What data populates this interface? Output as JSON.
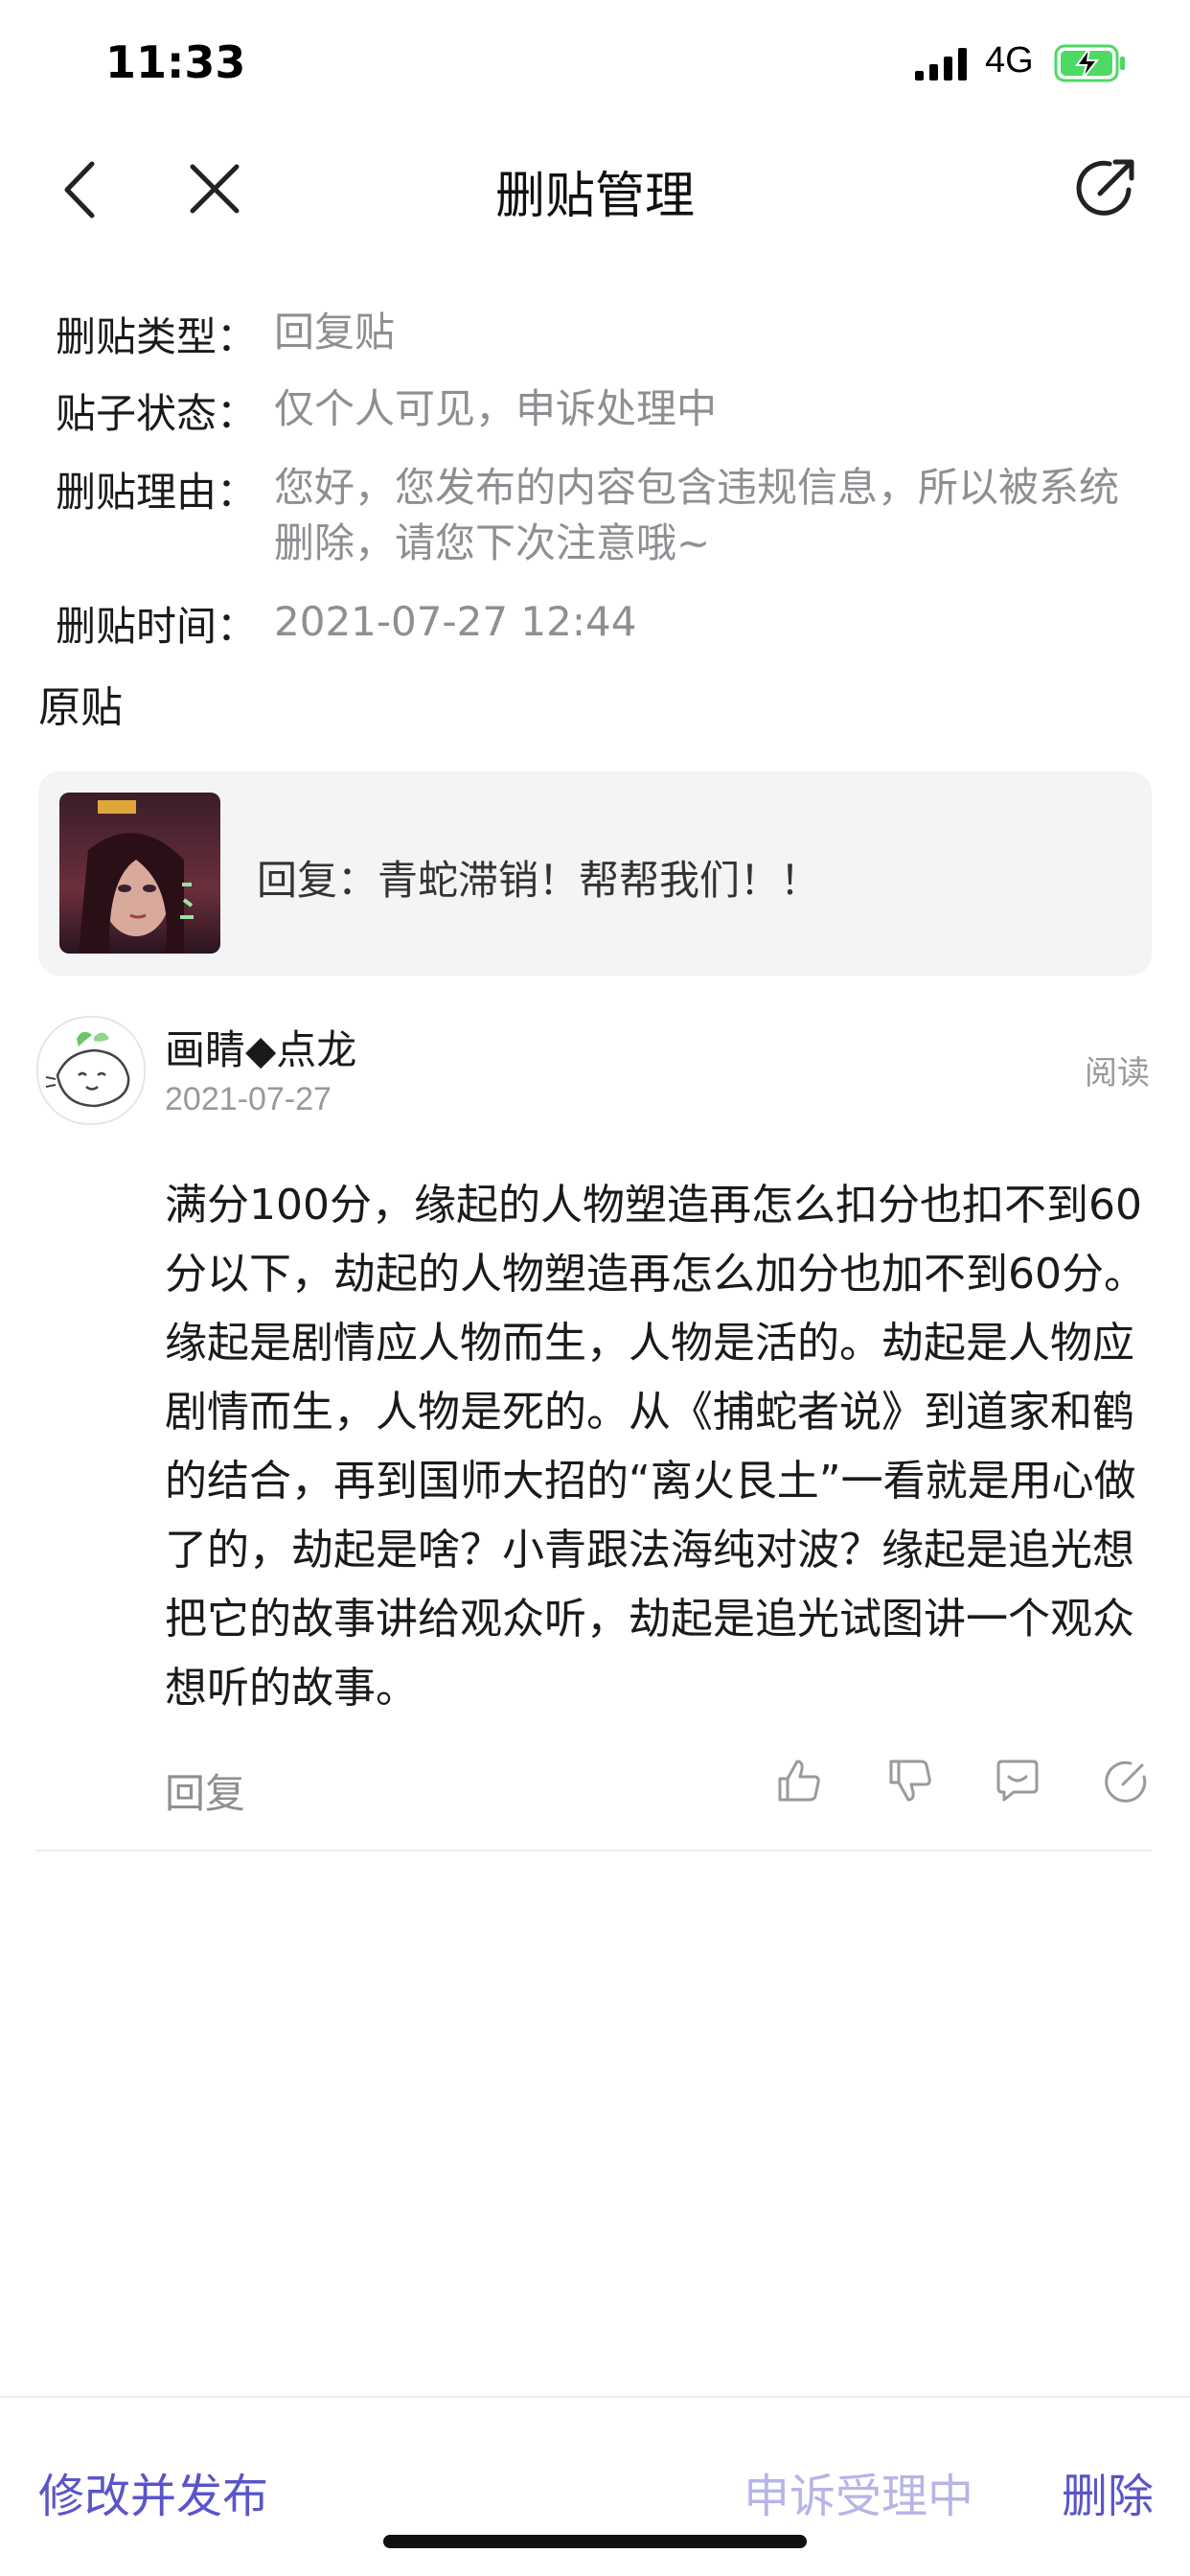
{
  "status_bar": {
    "time": "11:33",
    "network": "4G"
  },
  "nav": {
    "title": "删贴管理"
  },
  "info": [
    {
      "label": "删贴类型：",
      "value": "回复贴"
    },
    {
      "label": "贴子状态：",
      "value": "仅个人可见，申诉处理中"
    },
    {
      "label": "删贴理由：",
      "value": "您好，您发布的内容包含违规信息，所以被系统删除，请您下次注意哦~"
    },
    {
      "label": "删贴时间：",
      "value": "2021-07-27 12:44"
    }
  ],
  "original": {
    "section_title": "原贴",
    "reply_text": "回复：青蛇滞销！帮帮我们！！"
  },
  "comment": {
    "username": "画睛◆点龙",
    "date": "2021-07-27",
    "read_label": "阅读",
    "body": "满分100分，缘起的人物塑造再怎么扣分也扣不到60分以下，劫起的人物塑造再怎么加分也加不到60分。缘起是剧情应人物而生，人物是活的。劫起是人物应剧情而生，人物是死的。从《捕蛇者说》到道家和鹤的结合，再到国师大招的“离火艮土”一看就是用心做了的，劫起是啥？小青跟法海纯对波？缘起是追光想把它的故事讲给观众听，劫起是追光试图讲一个观众想听的故事。",
    "reply_label": "回复",
    "actions": [
      "thumbs-up-icon",
      "thumbs-down-icon",
      "comment-icon",
      "edit-icon"
    ]
  },
  "bottom": {
    "edit_label": "修改并发布",
    "appeal_label": "申诉受理中",
    "delete_label": "删除"
  },
  "colors": {
    "accent": "#5a55c8",
    "accent_disabled": "#b7b4e6",
    "battery": "#4cd964",
    "secondary_text": "#8e8e93"
  }
}
